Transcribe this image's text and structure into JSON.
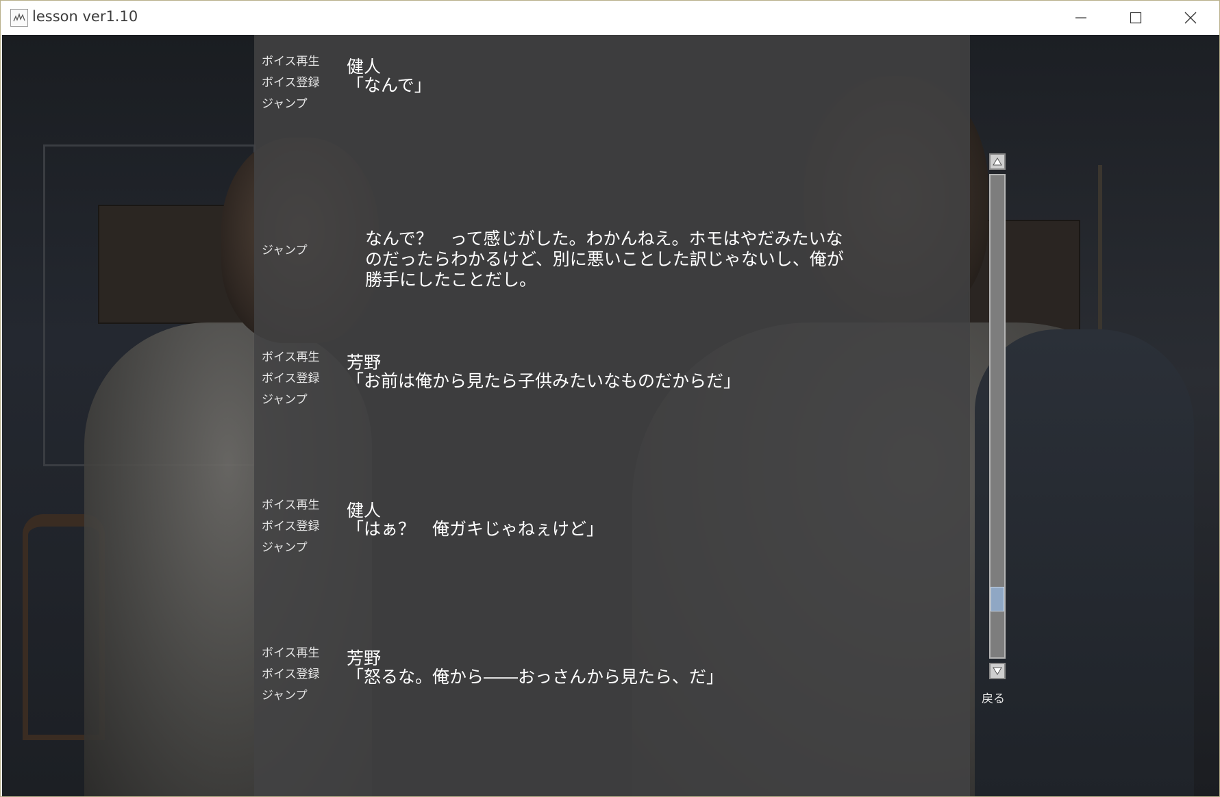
{
  "window": {
    "title": "lesson ver1.10",
    "icon": "app-icon",
    "controls": [
      "minimize-icon",
      "maximize-icon",
      "close-icon"
    ]
  },
  "log": {
    "entries": [
      {
        "type": "dialogue",
        "actions": [
          "ボイス再生",
          "ボイス登録",
          "ジャンプ"
        ],
        "speaker": "健人",
        "line": "「なんで」"
      },
      {
        "type": "narration",
        "actions": [
          "ジャンプ"
        ],
        "lines": [
          "なんで？　って感じがした。わかんねえ。ホモはやだみたいな",
          "のだったらわかるけど、別に悪いことした訳じゃないし、俺が",
          "勝手にしたことだし。"
        ]
      },
      {
        "type": "dialogue",
        "actions": [
          "ボイス再生",
          "ボイス登録",
          "ジャンプ"
        ],
        "speaker": "芳野",
        "line": "「お前は俺から見たら子供みたいなものだからだ」"
      },
      {
        "type": "dialogue",
        "actions": [
          "ボイス再生",
          "ボイス登録",
          "ジャンプ"
        ],
        "speaker": "健人",
        "line": "「はぁ？　俺ガキじゃねぇけど」"
      },
      {
        "type": "dialogue",
        "actions": [
          "ボイス再生",
          "ボイス登録",
          "ジャンプ"
        ],
        "speaker": "芳野",
        "line": "「怒るな。俺から――おっさんから見たら、だ」"
      }
    ]
  },
  "scrollbar": {
    "up_icon": "arrow-up-icon",
    "down_icon": "arrow-down-icon",
    "position_fraction": 0.9
  },
  "back_label": "戻る",
  "colors": {
    "panel": "#424244",
    "text": "#ffffff",
    "scroll_thumb": "#8fa7c4"
  }
}
